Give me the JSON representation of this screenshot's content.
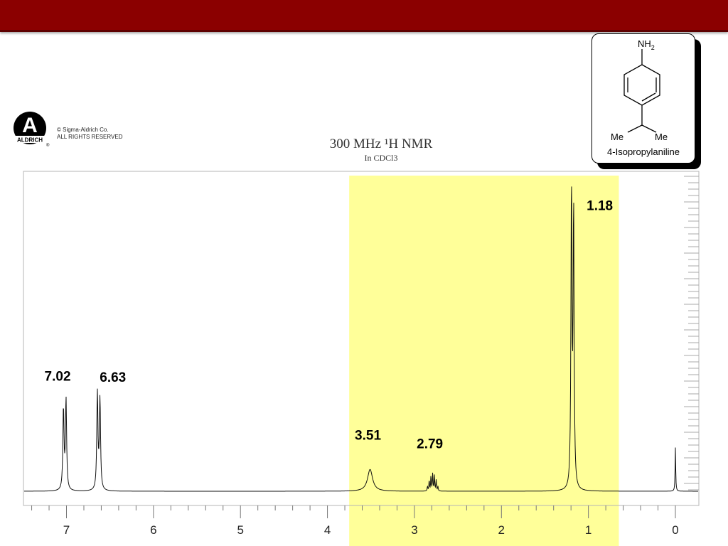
{
  "slide": {
    "header_color": "#8b0000"
  },
  "logo": {
    "letter": "A",
    "wordmark": "ALDRICH",
    "registered": "®"
  },
  "copyright": {
    "line1": "© Sigma-Aldrich Co.",
    "line2": "ALL RIGHTS RESERVED"
  },
  "structure": {
    "amine_label": "NH",
    "amine_subscript": "2",
    "methyl_left": "Me",
    "methyl_right": "Me",
    "compound_name": "4-Isopropylaniline"
  },
  "chart_data": {
    "type": "line",
    "title": "300 MHz ¹H NMR",
    "subtitle": "In CDCl3",
    "xlabel": "",
    "ylabel": "",
    "xlim": [
      7.5,
      -0.3
    ],
    "x_reversed": true,
    "x_ticks": [
      "7",
      "6",
      "5",
      "4",
      "3",
      "2",
      "1",
      "0"
    ],
    "x_tick_values": [
      7,
      6,
      5,
      4,
      3,
      2,
      1,
      0
    ],
    "grid": false,
    "highlight_region": {
      "x_range": [
        3.75,
        0.65
      ],
      "color": "#ffff99"
    },
    "peaks": [
      {
        "shift": 7.02,
        "label": "7.02",
        "lines": [
          [
            7.035,
            0.26
          ],
          [
            7.005,
            0.29
          ]
        ],
        "width": 0.008
      },
      {
        "shift": 6.63,
        "label": "6.63",
        "lines": [
          [
            6.645,
            0.31
          ],
          [
            6.615,
            0.29
          ]
        ],
        "width": 0.008
      },
      {
        "shift": 3.51,
        "label": "3.51",
        "lines": [
          [
            3.51,
            0.07
          ]
        ],
        "width": 0.035
      },
      {
        "shift": 2.79,
        "label": "2.79",
        "lines": [
          [
            2.85,
            0.015
          ],
          [
            2.83,
            0.035
          ],
          [
            2.81,
            0.05
          ],
          [
            2.79,
            0.058
          ],
          [
            2.77,
            0.05
          ],
          [
            2.75,
            0.035
          ],
          [
            2.73,
            0.015
          ]
        ],
        "width": 0.004
      },
      {
        "shift": 1.18,
        "label": "1.18",
        "lines": [
          [
            1.195,
            0.96
          ],
          [
            1.17,
            0.89
          ]
        ],
        "width": 0.007
      },
      {
        "shift": 0.0,
        "label": "",
        "lines": [
          [
            0.0,
            0.14
          ]
        ],
        "width": 0.004
      }
    ]
  }
}
